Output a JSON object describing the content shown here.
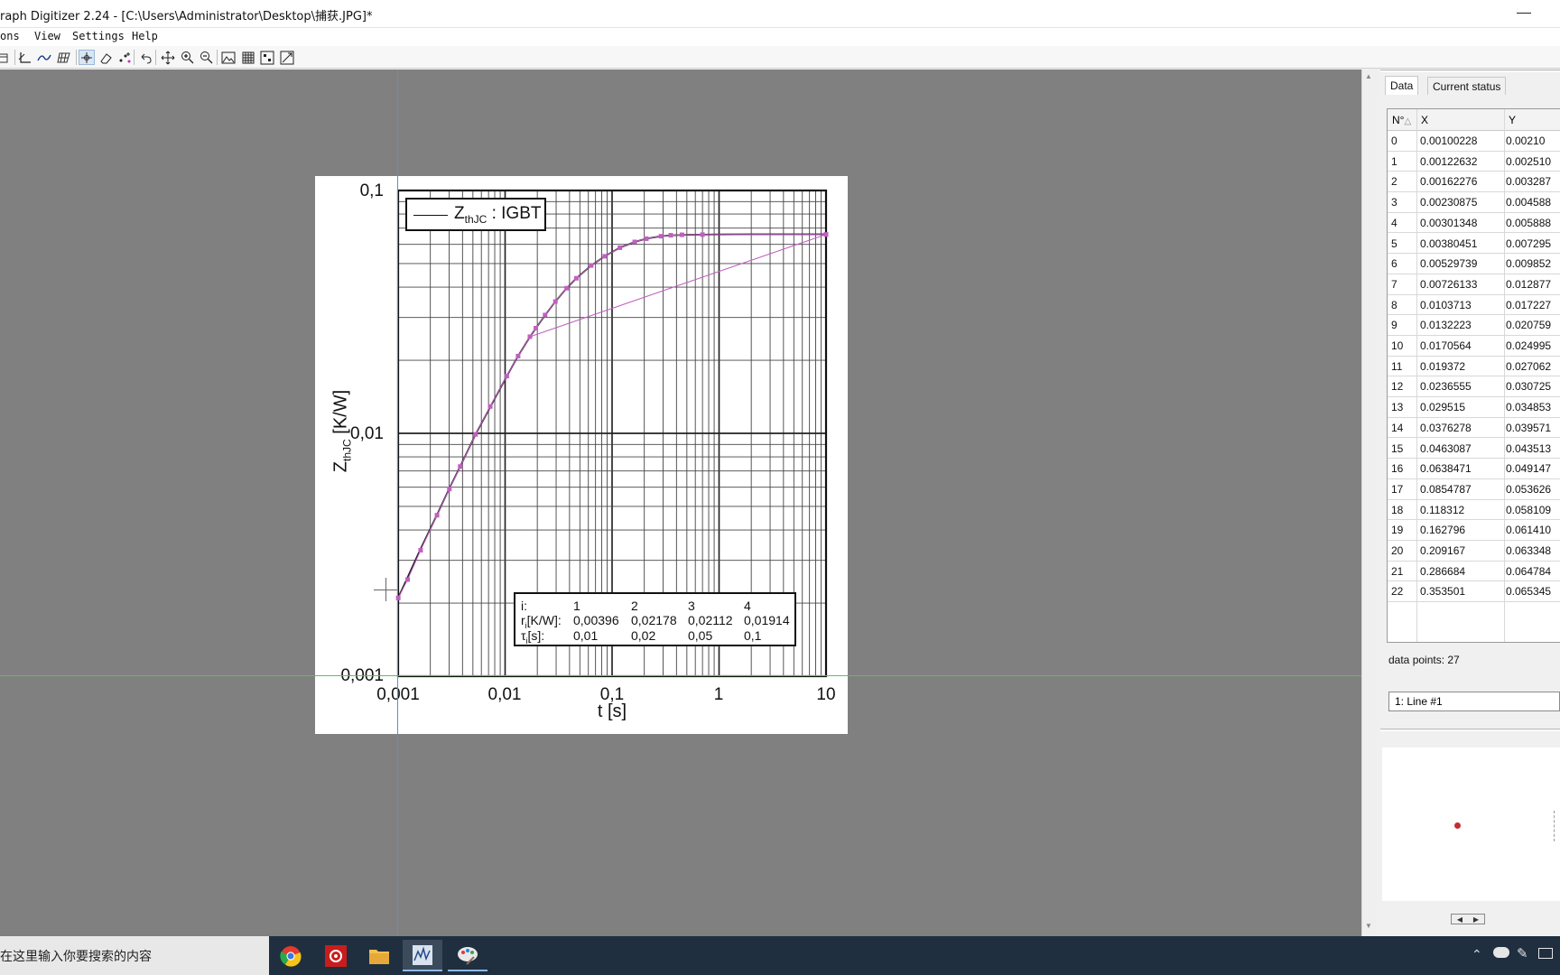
{
  "window": {
    "title": "raph Digitizer 2.24 - [C:\\Users\\Administrator\\Desktop\\捕获.JPG]*"
  },
  "menu": [
    "ons",
    "View",
    "Settings",
    "Help"
  ],
  "toolbar_icons": [
    "open-icon",
    "axes-icon",
    "curve-icon",
    "grid-icon",
    "point-icon",
    "eraser-icon",
    "select-icon",
    "undo-icon",
    "pan-icon",
    "zoom-in-icon",
    "zoom-out-icon",
    "image-icon",
    "mesh-icon",
    "points-icon",
    "fit-icon"
  ],
  "graph": {
    "y_ticks": [
      "0,1",
      "0,01",
      "0,001"
    ],
    "x_ticks": [
      "0,001",
      "0,01",
      "0,1",
      "1",
      "10"
    ],
    "ylabel_main": "Z",
    "ylabel_sub": "thJC",
    "ylabel_unit": " [K/W]",
    "xlabel": "t [s]",
    "legend_main": "Z",
    "legend_sub": "thJC",
    "legend_rest": " : IGBT",
    "table": {
      "row1": [
        "i:",
        "1",
        "2",
        "3",
        "4"
      ],
      "row2_label": "[K/W]:",
      "row2_prefix": "r",
      "row2_sub": "i",
      "row2": [
        "0,00396",
        "0,02178",
        "0,02112",
        "0,01914"
      ],
      "row3_label": "[s]:",
      "row3_prefix": "τ",
      "row3_sub": "i",
      "row3": [
        "0,01",
        "0,02",
        "0,05",
        "0,1"
      ]
    },
    "accent": "#c060c0",
    "curve_color": "#1a1a1a"
  },
  "chart_data": {
    "type": "line",
    "xscale": "log",
    "yscale": "log",
    "xlim": [
      0.001,
      10
    ],
    "ylim": [
      0.001,
      0.1
    ],
    "xlabel": "t [s]",
    "ylabel": "ZthJC [K/W]",
    "legend": "ZthJC : IGBT",
    "grid": true,
    "series": [
      {
        "name": "ZthJC : IGBT",
        "x": [
          0.001,
          0.0012,
          0.0016,
          0.0023,
          0.003,
          0.0038,
          0.0053,
          0.0073,
          0.0104,
          0.0132,
          0.0171,
          0.0194,
          0.0237,
          0.0295,
          0.0376,
          0.0463,
          0.0638,
          0.0855,
          0.118,
          0.163,
          0.209,
          0.287,
          0.354,
          0.5,
          0.7,
          1,
          2,
          5,
          10
        ],
        "y": [
          0.0021,
          0.0025,
          0.0033,
          0.0046,
          0.0059,
          0.0073,
          0.0099,
          0.0129,
          0.0172,
          0.0208,
          0.025,
          0.0271,
          0.0307,
          0.0349,
          0.0396,
          0.0435,
          0.0491,
          0.0536,
          0.0581,
          0.0614,
          0.0633,
          0.0648,
          0.0654,
          0.0657,
          0.0658,
          0.0659,
          0.066,
          0.066,
          0.066
        ]
      }
    ],
    "table_values": {
      "i": [
        1,
        2,
        3,
        4
      ],
      "r_KW": [
        0.00396,
        0.02178,
        0.02112,
        0.01914
      ],
      "tau_s": [
        0.01,
        0.02,
        0.05,
        0.1
      ]
    }
  },
  "digitized": {
    "x": [
      0.00100228,
      0.00122632,
      0.00162276,
      0.00230875,
      0.00301348,
      0.00380451,
      0.00529739,
      0.00726133,
      0.0103713,
      0.0132223,
      0.0170564,
      0.019372,
      0.0236555,
      0.029515,
      0.0376278,
      0.0463087,
      0.0638471,
      0.0854787,
      0.118312,
      0.162796,
      0.209167,
      0.286684,
      0.353501,
      0.45,
      0.7,
      10,
      10
    ],
    "y": [
      0.0021,
      0.0025,
      0.0033,
      0.0046,
      0.0059,
      0.0073,
      0.0099,
      0.0129,
      0.0172,
      0.0208,
      0.025,
      0.0271,
      0.0307,
      0.0349,
      0.0396,
      0.0435,
      0.0491,
      0.0536,
      0.0581,
      0.0614,
      0.0633,
      0.0648,
      0.0654,
      0.0657,
      0.0658,
      0.0659,
      0.0659
    ]
  },
  "panel": {
    "tabs": [
      "Data",
      "Current status"
    ],
    "columns": [
      "N°",
      "X",
      "Y"
    ],
    "rows": [
      [
        "0",
        "0.00100228",
        "0.00210"
      ],
      [
        "1",
        "0.00122632",
        "0.002510"
      ],
      [
        "2",
        "0.00162276",
        "0.003287"
      ],
      [
        "3",
        "0.00230875",
        "0.004588"
      ],
      [
        "4",
        "0.00301348",
        "0.005888"
      ],
      [
        "5",
        "0.00380451",
        "0.007295"
      ],
      [
        "6",
        "0.00529739",
        "0.009852"
      ],
      [
        "7",
        "0.00726133",
        "0.012877"
      ],
      [
        "8",
        "0.0103713",
        "0.017227"
      ],
      [
        "9",
        "0.0132223",
        "0.020759"
      ],
      [
        "10",
        "0.0170564",
        "0.024995"
      ],
      [
        "11",
        "0.019372",
        "0.027062"
      ],
      [
        "12",
        "0.0236555",
        "0.030725"
      ],
      [
        "13",
        "0.029515",
        "0.034853"
      ],
      [
        "14",
        "0.0376278",
        "0.039571"
      ],
      [
        "15",
        "0.0463087",
        "0.043513"
      ],
      [
        "16",
        "0.0638471",
        "0.049147"
      ],
      [
        "17",
        "0.0854787",
        "0.053626"
      ],
      [
        "18",
        "0.118312",
        "0.058109"
      ],
      [
        "19",
        "0.162796",
        "0.061410"
      ],
      [
        "20",
        "0.209167",
        "0.063348"
      ],
      [
        "21",
        "0.286684",
        "0.064784"
      ],
      [
        "22",
        "0.353501",
        "0.065345"
      ]
    ],
    "data_points": "data points: 27",
    "line_select": "1: Line #1"
  },
  "taskbar": {
    "search_placeholder": "在这里输入你要搜索的内容",
    "apps": [
      "chrome-icon",
      "settings-app-icon",
      "file-explorer-icon",
      "graph-digitizer-icon",
      "paint-icon"
    ]
  }
}
